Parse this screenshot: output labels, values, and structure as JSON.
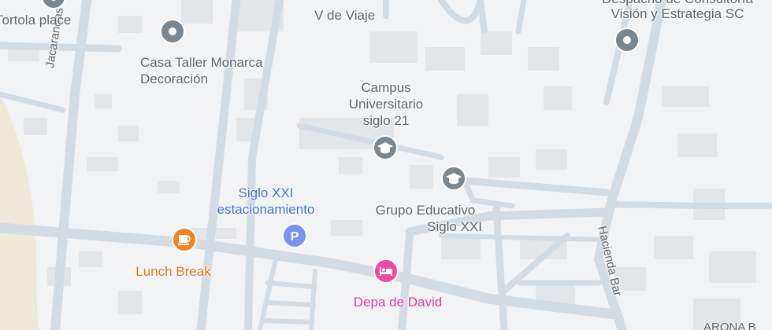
{
  "colors": {
    "background": "#f1f3f4",
    "road": "#d3dbe3",
    "road_edge": "#c2ccd6",
    "building": "#e3e6e9",
    "sand": "#efe9d8",
    "poi_gray": "#7b868f",
    "label_gray": "#5f6368",
    "parking": "#7b93f0",
    "parking_label": "#3c6fd8",
    "cafe": "#f2831f",
    "cafe_label": "#e0741c",
    "hotel": "#ec4aa3",
    "hotel_label": "#e8319b"
  },
  "streets": {
    "jacarandas": "Jacarandas",
    "hacienda": "Hacienda Bar"
  },
  "places": {
    "tortola": {
      "name": "Tortola place",
      "icon": "pin-icon"
    },
    "viaje": {
      "name": "V de Viaje"
    },
    "despacho": {
      "line1": "Despacho de Consultoría",
      "line2": "Visión y Estrategia SC",
      "icon": "pin-icon"
    },
    "casa_taller": {
      "line1": "Casa Taller Monarca",
      "line2": "Decoración",
      "icon": "pin-icon"
    },
    "campus": {
      "line1": "Campus",
      "line2": "Universitario",
      "line3": "siglo 21",
      "icon": "school-icon"
    },
    "grupo": {
      "line1": "Grupo Educativo",
      "line2": "Siglo XXI",
      "icon": "school-icon"
    },
    "estacionamiento": {
      "line1": "Siglo XXI",
      "line2": "estacionamiento",
      "icon": "parking-icon",
      "glyph": "P"
    },
    "lunch": {
      "name": "Lunch Break",
      "icon": "cafe-icon"
    },
    "depa": {
      "name": "Depa de David",
      "icon": "hotel-icon"
    },
    "arona": {
      "name": "ARONA B"
    }
  }
}
